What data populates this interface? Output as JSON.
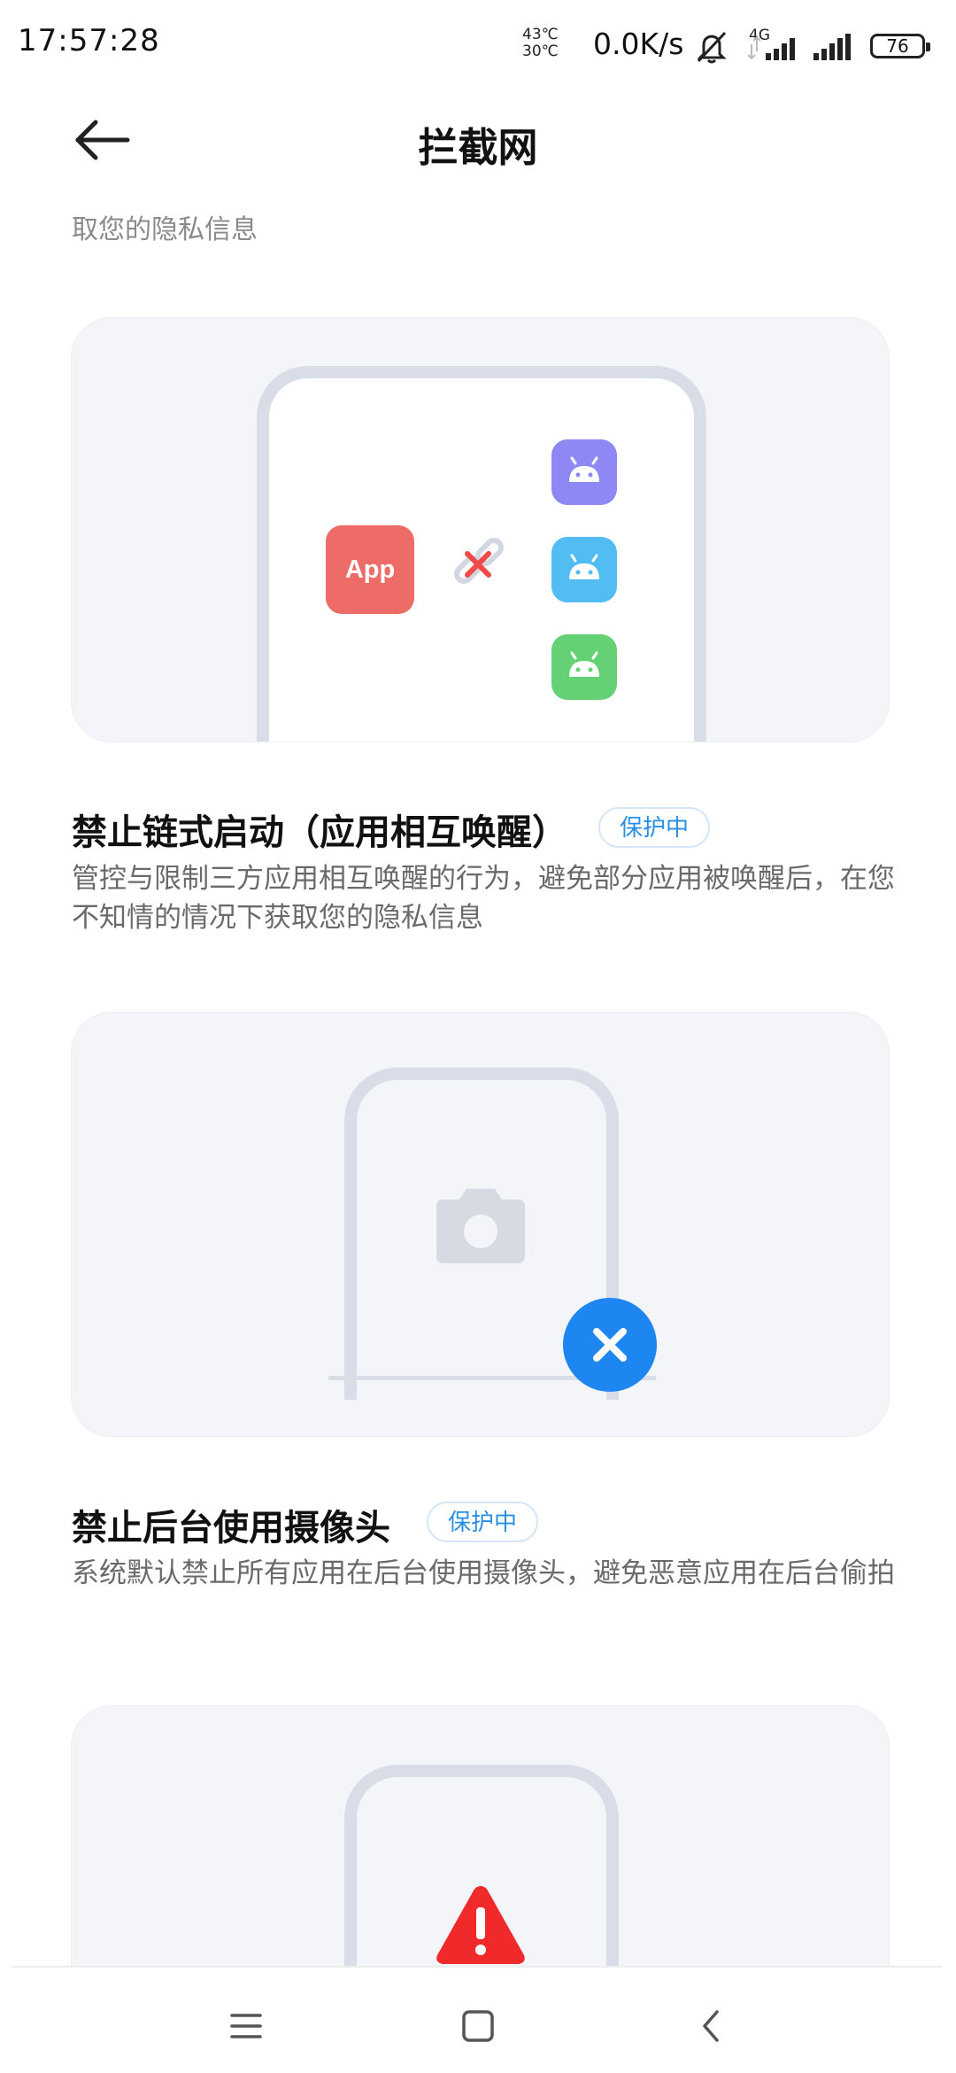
{
  "status_bar": {
    "time": "17:57:28",
    "temp_high": "43℃",
    "temp_low": "30℃",
    "net_speed": "0.0K/s",
    "network_type": "4G",
    "battery": "76",
    "icons": [
      "mute-icon",
      "signal-icon",
      "signal-icon",
      "battery-icon"
    ]
  },
  "header": {
    "title": "拦截网",
    "back_icon": "arrow-left-icon"
  },
  "partial_text": "取您的隐私信息",
  "sections": [
    {
      "title": "禁止链式启动（应用相互唤醒）",
      "badge": "保护中",
      "description": "管控与限制三方应用相互唤醒的行为，避免部分应用被唤醒后，在您不知情的情况下获取您的隐私信息",
      "illustration": {
        "app_label": "App",
        "icons": [
          "broken-link-icon",
          "android-icon",
          "android-icon",
          "android-icon"
        ],
        "colors": {
          "app": "#ee6c67",
          "purple": "#8e88f5",
          "blue": "#52bdf3",
          "green": "#63d174",
          "cross": "#f04a4a"
        }
      }
    },
    {
      "title": "禁止后台使用摄像头",
      "badge": "保护中",
      "description": "系统默认禁止所有应用在后台使用摄像头，避免恶意应用在后台偷拍",
      "illustration": {
        "icons": [
          "camera-icon",
          "close-circle-icon"
        ],
        "colors": {
          "close_circle": "#1e86f0",
          "camera": "#d6dae3"
        }
      }
    },
    {
      "illustration": {
        "icons": [
          "warning-icon"
        ],
        "colors": {
          "warning": "#f02a2a"
        }
      }
    }
  ],
  "nav_bar": {
    "icons": [
      "menu-icon",
      "home-icon",
      "back-icon"
    ]
  },
  "colors": {
    "accent": "#2a8fe4",
    "card_bg": "#f4f5f9",
    "frame": "#d9dde8"
  }
}
